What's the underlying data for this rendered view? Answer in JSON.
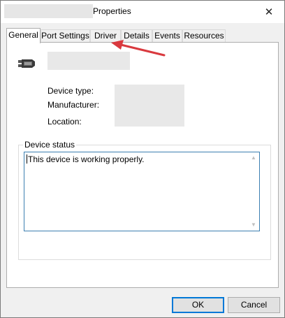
{
  "window": {
    "title": "Properties",
    "close_glyph": "✕"
  },
  "tabs": [
    {
      "label": "General",
      "active": true
    },
    {
      "label": "Port Settings",
      "active": false
    },
    {
      "label": "Driver",
      "active": false
    },
    {
      "label": "Details",
      "active": false
    },
    {
      "label": "Events",
      "active": false
    },
    {
      "label": "Resources",
      "active": false
    }
  ],
  "general": {
    "device_icon": "port-connector-icon",
    "properties": {
      "device_type_label": "Device type:",
      "manufacturer_label": "Manufacturer:",
      "location_label": "Location:"
    },
    "device_status": {
      "legend": "Device status",
      "text": "This device is working properly."
    }
  },
  "buttons": {
    "ok": "OK",
    "cancel": "Cancel"
  },
  "annotation": {
    "arrow_color": "#d9393e"
  }
}
